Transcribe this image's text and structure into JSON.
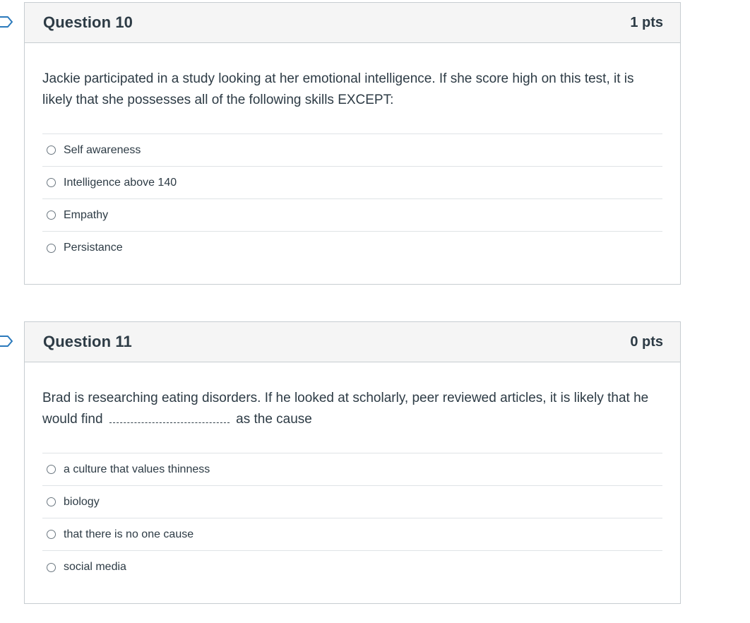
{
  "questions": [
    {
      "title": "Question 10",
      "points": "1 pts",
      "text": "Jackie participated in a study looking at her emotional intelligence. If she score high on this test, it is likely that she possesses all of the following skills EXCEPT:",
      "answers": [
        "Self awareness",
        "Intelligence above 140",
        "Empathy",
        "Persistance"
      ]
    },
    {
      "title": "Question 11",
      "points": "0 pts",
      "text_before": "Brad is researching eating disorders. If he looked at scholarly, peer reviewed articles, it is likely that he would find",
      "text_after": "as the cause",
      "answers": [
        "a culture that values thinness",
        "biology",
        "that there is no one cause",
        "social media"
      ]
    }
  ],
  "icons": {
    "flag": "bookmark-flag-icon",
    "radio": "radio-button-icon"
  },
  "colors": {
    "text": "#2d3b45",
    "header_bg": "#f5f5f5",
    "border": "#c7cdd1",
    "flag": "#2b7abc"
  }
}
